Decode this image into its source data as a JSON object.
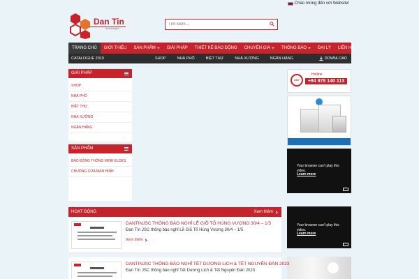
{
  "topbar": {
    "welcome": "Chào mừng đến với Website!"
  },
  "brand": {
    "name": "Dan Tin",
    "tagline": "Technologies"
  },
  "search": {
    "placeholder": "Tìm kiếm..."
  },
  "nav": {
    "items": [
      {
        "label": "Trang chủ",
        "active": true,
        "caret": false
      },
      {
        "label": "Giới thiệu",
        "active": false,
        "caret": false
      },
      {
        "label": "Sản phẩm",
        "active": false,
        "caret": true
      },
      {
        "label": "Giải pháp",
        "active": false,
        "caret": false
      },
      {
        "label": "Thiết kế báo động",
        "active": false,
        "caret": false
      },
      {
        "label": "Chuyên gia",
        "active": false,
        "caret": true
      },
      {
        "label": "Thông báo",
        "active": false,
        "caret": true
      },
      {
        "label": "Đại lý",
        "active": false,
        "caret": false
      },
      {
        "label": "Liên hệ",
        "active": false,
        "caret": false
      }
    ]
  },
  "subnav": {
    "catalogue": "CATALOGUE 2019",
    "links": [
      "SHOP",
      "NHÀ PHỐ",
      "BIỆT THỰ",
      "NHÀ XƯỞNG",
      "NGÂN HÀNG"
    ],
    "download": "DOWNLOAD"
  },
  "sidebar": {
    "solutions": {
      "title": "Giải pháp",
      "items": [
        "Shop",
        "Nhà phố",
        "Biệt thự",
        "Nhà xưởng",
        "Ngân hàng"
      ]
    },
    "products": {
      "title": "Sản phẩm",
      "items": [
        "Báo động thông minh Eldes",
        "Chuông cửa màn hình"
      ]
    }
  },
  "hotline": {
    "badge": "24/7",
    "label": "Hotline",
    "number": "+84 978 140 113"
  },
  "video": {
    "message_line1": "Your browser can't play this",
    "message_line2": "video.",
    "learn_more": "Learn more"
  },
  "activity": {
    "title": "Hoạt động",
    "more": "Xem thêm",
    "items": [
      {
        "title": "DANTINJSC THÔNG BÁO NGHỈ LỄ GIỖ TỔ HÙNG VƯƠNG 30/4 – 1/5",
        "desc": "Đan Tín JSC thông báo nghỉ Lễ Giỗ Tổ Hùng Vương 30/4 – 1/5",
        "more": "Xem thêm"
      },
      {
        "title": "DANTINJSC THÔNG BÁO NGHỈ TẾT DƯƠNG LỊCH & TẾT NGUYÊN ĐÁN 2023",
        "desc": "Đan Tín JSC thông báo nghỉ Tết Dương Lịch & Tết Nguyên Đán 2023",
        "more": ""
      }
    ]
  },
  "colors": {
    "brand_red": "#c8222b",
    "nav_dark": "#2d2d2d",
    "background": "#eaf4f8"
  }
}
